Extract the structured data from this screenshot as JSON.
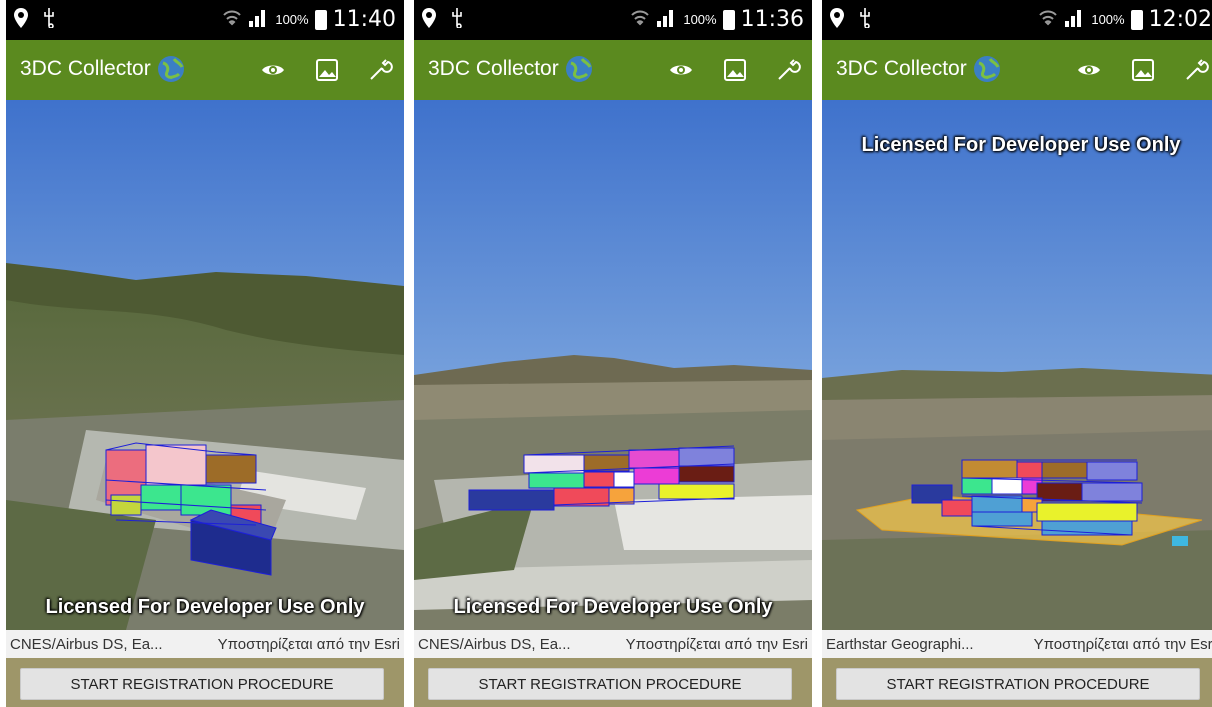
{
  "screens": [
    {
      "status": {
        "battery_pct": "100%",
        "time": "11:40"
      },
      "app": {
        "title": "3DC Collector"
      },
      "map": {
        "license_text": "Licensed For Developer Use Only",
        "attribution_left": "CNES/Airbus DS, Ea...",
        "attribution_right": "Υποστηρίζεται από την Esri"
      },
      "button": {
        "label": "START REGISTRATION PROCEDURE"
      }
    },
    {
      "status": {
        "battery_pct": "100%",
        "time": "11:36"
      },
      "app": {
        "title": "3DC Collector"
      },
      "map": {
        "license_text": "Licensed For Developer Use Only",
        "attribution_left": "CNES/Airbus DS, Ea...",
        "attribution_right": "Υποστηρίζεται από την Esri"
      },
      "button": {
        "label": "START REGISTRATION PROCEDURE"
      }
    },
    {
      "status": {
        "battery_pct": "100%",
        "time": "12:02"
      },
      "app": {
        "title": "3DC Collector"
      },
      "map": {
        "license_text": "Licensed For Developer Use Only",
        "attribution_left": "Earthstar Geographi...",
        "attribution_right": "Υποστηρίζεται από την Esri"
      },
      "button": {
        "label": "START REGISTRATION PROCEDURE"
      }
    }
  ],
  "icons": {
    "status_left": [
      "location-pin-icon",
      "usb-icon"
    ],
    "status_right": [
      "wifi-icon",
      "signal-icon",
      "battery-icon"
    ],
    "app_actions": [
      "eye-icon",
      "image-icon",
      "wrench-icon"
    ],
    "app_logo": "globe-icon"
  },
  "colors": {
    "app_bar": "#5b8a1f",
    "button_bar": "#9e9669",
    "sky_top": "#3f72cc",
    "sky_bottom": "#9fc6ea",
    "building_outline": "#1d1fd8"
  }
}
